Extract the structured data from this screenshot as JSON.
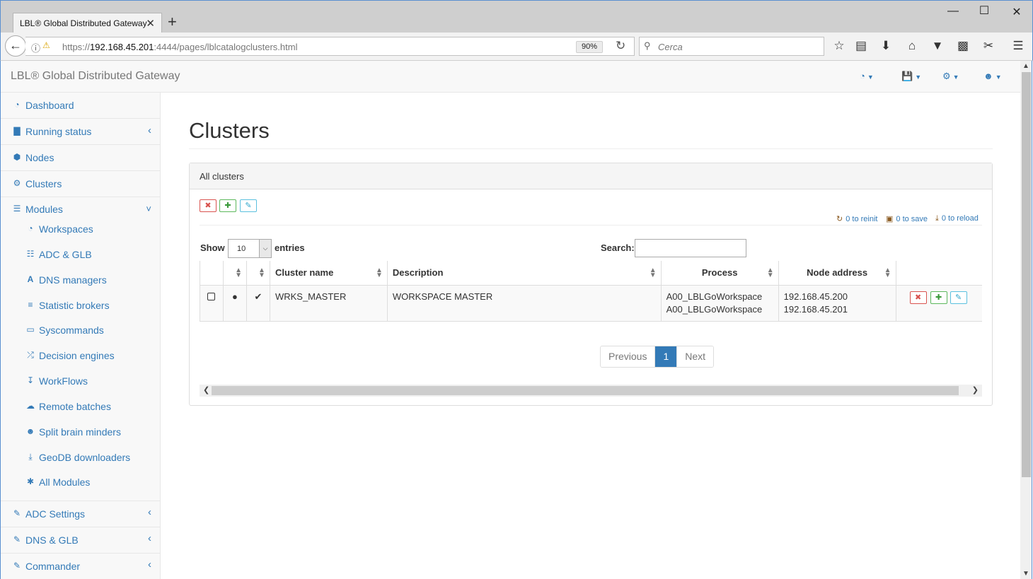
{
  "browser": {
    "tab_title": "LBL® Global Distributed Gateway",
    "tab_close": "✕",
    "new_tab": "+",
    "url_base": "https://",
    "url_host": "192.168.45.201",
    "url_path": ":4444/pages/lblcatalogclusters.html",
    "zoom": "90%",
    "search_placeholder": "Cerca"
  },
  "app": {
    "brand": "LBL® Global Distributed Gateway"
  },
  "sidebar": {
    "items": [
      {
        "label": "Dashboard",
        "icon": "dashboard-icon",
        "glyph": "◔"
      },
      {
        "label": "Running status",
        "icon": "bar-chart-icon",
        "glyph": "▇",
        "arrow": "‹"
      },
      {
        "label": "Nodes",
        "icon": "cube-icon",
        "glyph": "⬢"
      },
      {
        "label": "Clusters",
        "icon": "cogs-icon",
        "glyph": "⚙"
      },
      {
        "label": "Modules",
        "icon": "list-alt-icon",
        "glyph": "☰",
        "arrow": "˅"
      }
    ],
    "subitems": [
      {
        "label": "Workspaces",
        "icon": "dashboard-icon",
        "glyph": "◔"
      },
      {
        "label": "ADC & GLB",
        "icon": "sitemap-icon",
        "glyph": "☷"
      },
      {
        "label": "DNS managers",
        "icon": "font-icon",
        "glyph": "A"
      },
      {
        "label": "Statistic brokers",
        "icon": "database-icon",
        "glyph": "≡"
      },
      {
        "label": "Syscommands",
        "icon": "laptop-icon",
        "glyph": "▭"
      },
      {
        "label": "Decision engines",
        "icon": "random-icon",
        "glyph": "⤮"
      },
      {
        "label": "WorkFlows",
        "icon": "sort-numeric-icon",
        "glyph": "↧"
      },
      {
        "label": "Remote batches",
        "icon": "cloud-upload-icon",
        "glyph": "☁"
      },
      {
        "label": "Split brain minders",
        "icon": "users-icon",
        "glyph": "☻"
      },
      {
        "label": "GeoDB downloaders",
        "icon": "download-icon",
        "glyph": "⤓"
      },
      {
        "label": "All Modules",
        "icon": "asterisk-icon",
        "glyph": "✱"
      }
    ],
    "bottom_items": [
      {
        "label": "ADC Settings",
        "icon": "edit-icon",
        "glyph": "✎",
        "arrow": "‹"
      },
      {
        "label": "DNS & GLB",
        "icon": "edit-icon",
        "glyph": "✎",
        "arrow": "‹"
      },
      {
        "label": "Commander",
        "icon": "edit-icon",
        "glyph": "✎",
        "arrow": "‹"
      }
    ]
  },
  "main": {
    "title": "Clusters",
    "panel_title": "All clusters",
    "status": {
      "reinit": "0 to reinit",
      "save": "0 to save",
      "reload": "0 to reload"
    },
    "length": {
      "show": "Show",
      "value": "10",
      "entries": "entries"
    },
    "search_label": "Search:",
    "table": {
      "headers": [
        "Cluster name",
        "Description",
        "Process",
        "Node address"
      ],
      "rows": [
        {
          "cluster_name": "WRKS_MASTER",
          "description": "WORKSPACE MASTER",
          "process_1": "A00_LBLGoWorkspace",
          "process_2": "A00_LBLGoWorkspace",
          "node_1": "192.168.45.200",
          "node_2": "192.168.45.201"
        }
      ]
    },
    "pagination": {
      "previous": "Previous",
      "current": "1",
      "next": "Next"
    }
  },
  "colors": {
    "link": "#337ab7",
    "danger": "#d9534f",
    "success": "#5cb85c",
    "info": "#5bc0de"
  }
}
